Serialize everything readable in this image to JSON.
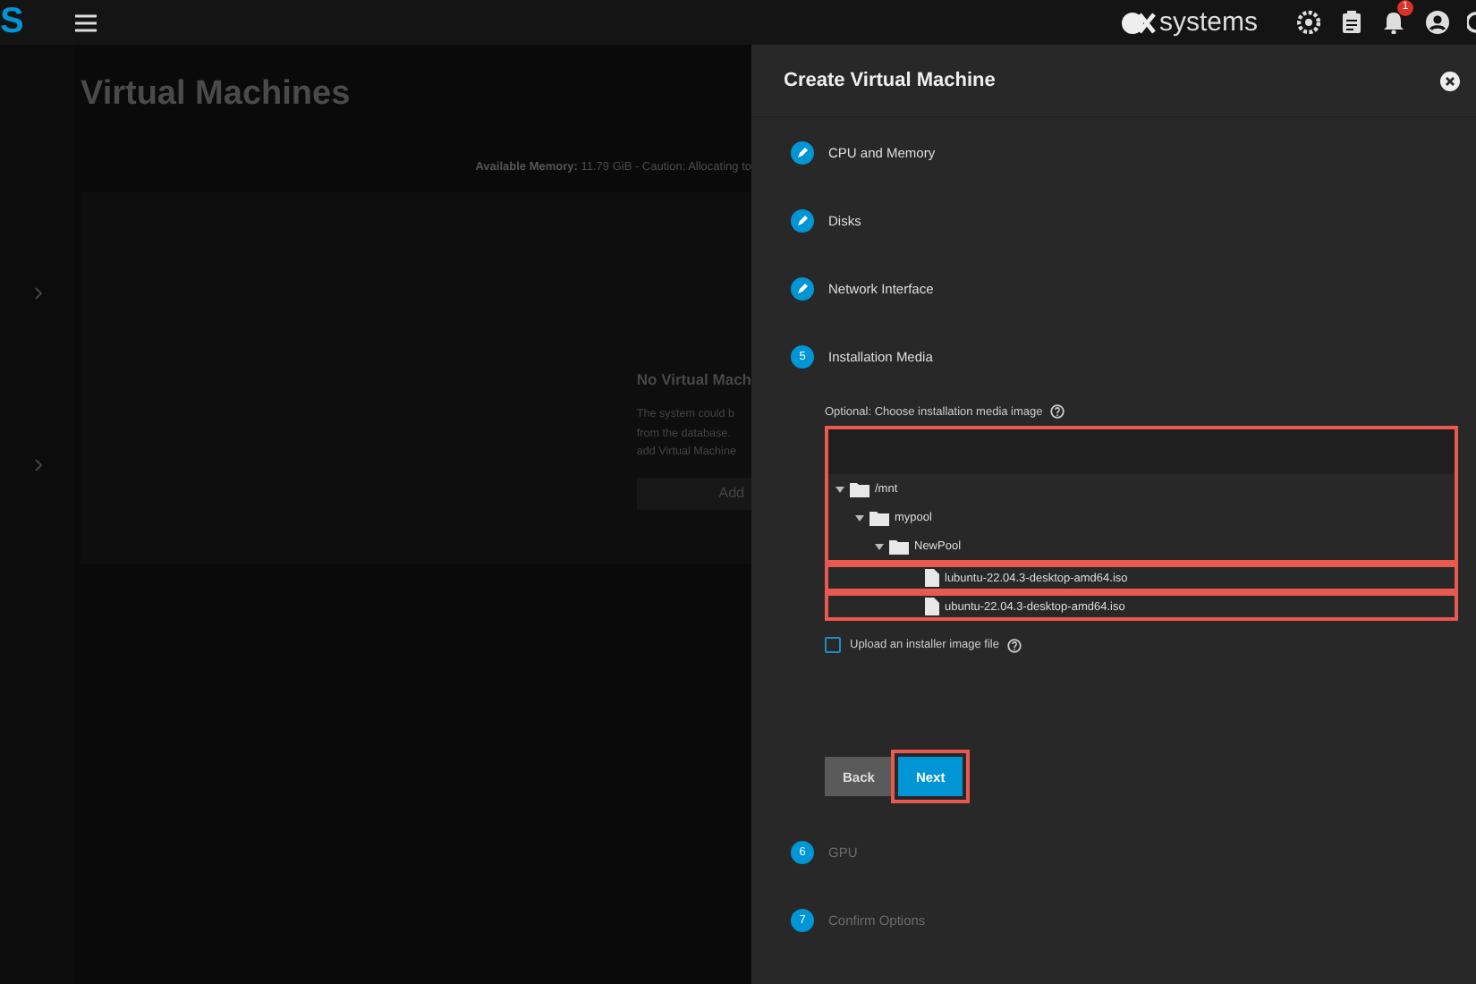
{
  "topbar": {
    "logo_fragment": "S",
    "brand": "systems",
    "notification_badge": "1"
  },
  "page": {
    "title": "Virtual Machines",
    "memory_label": "Available Memory:",
    "memory_text": "11.79 GiB - Caution: Allocating to",
    "empty_title": "No Virtual Mach",
    "empty_lines": [
      "The system could b",
      "from the database.",
      "add Virtual Machine"
    ],
    "add_button": "Add"
  },
  "panel": {
    "title": "Create Virtual Machine",
    "steps": [
      {
        "kind": "done",
        "label": "CPU and Memory"
      },
      {
        "kind": "done",
        "label": "Disks"
      },
      {
        "kind": "done",
        "label": "Network Interface"
      },
      {
        "kind": "current",
        "number": "5",
        "label": "Installation Media"
      },
      {
        "kind": "upcoming",
        "number": "6",
        "label": "GPU"
      },
      {
        "kind": "upcoming",
        "number": "7",
        "label": "Confirm Options"
      }
    ],
    "media_field": {
      "label": "Optional: Choose installation media image",
      "highlighted": true,
      "tree": [
        {
          "name": "/mnt",
          "kind": "folder",
          "expanded": true,
          "highlighted": false,
          "children": [
            {
              "name": "mypool",
              "kind": "folder",
              "expanded": true,
              "highlighted": false,
              "children": [
                {
                  "name": "NewPool",
                  "kind": "folder",
                  "expanded": true,
                  "highlighted": false,
                  "children": [
                    {
                      "name": "lubuntu-22.04.3-desktop-amd64.iso",
                      "kind": "file",
                      "highlighted": true
                    },
                    {
                      "name": "ubuntu-22.04.3-desktop-amd64.iso",
                      "kind": "file",
                      "highlighted": true
                    }
                  ]
                }
              ]
            }
          ]
        }
      ]
    },
    "upload_checkbox": {
      "label": "Upload an installer image file",
      "checked": false
    },
    "buttons": [
      {
        "label": "Back",
        "kind": "secondary",
        "highlighted": false
      },
      {
        "label": "Next",
        "kind": "primary",
        "highlighted": true
      }
    ]
  }
}
